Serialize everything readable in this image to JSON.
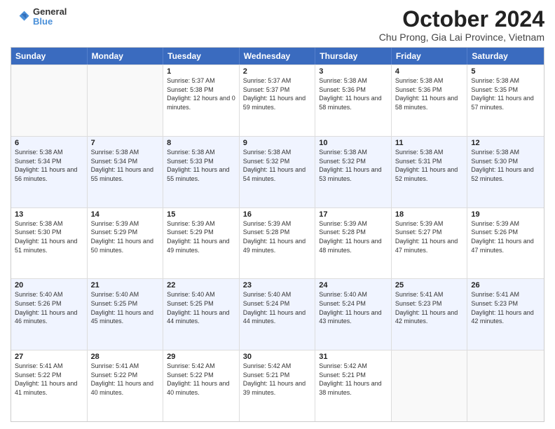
{
  "header": {
    "logo_line1": "General",
    "logo_line2": "Blue",
    "title": "October 2024",
    "subtitle": "Chu Prong, Gia Lai Province, Vietnam"
  },
  "calendar": {
    "days_of_week": [
      "Sunday",
      "Monday",
      "Tuesday",
      "Wednesday",
      "Thursday",
      "Friday",
      "Saturday"
    ],
    "rows": [
      [
        {
          "day": "",
          "sunrise": "",
          "sunset": "",
          "daylight": "",
          "empty": true
        },
        {
          "day": "",
          "sunrise": "",
          "sunset": "",
          "daylight": "",
          "empty": true
        },
        {
          "day": "1",
          "sunrise": "Sunrise: 5:37 AM",
          "sunset": "Sunset: 5:38 PM",
          "daylight": "Daylight: 12 hours and 0 minutes."
        },
        {
          "day": "2",
          "sunrise": "Sunrise: 5:37 AM",
          "sunset": "Sunset: 5:37 PM",
          "daylight": "Daylight: 11 hours and 59 minutes."
        },
        {
          "day": "3",
          "sunrise": "Sunrise: 5:38 AM",
          "sunset": "Sunset: 5:36 PM",
          "daylight": "Daylight: 11 hours and 58 minutes."
        },
        {
          "day": "4",
          "sunrise": "Sunrise: 5:38 AM",
          "sunset": "Sunset: 5:36 PM",
          "daylight": "Daylight: 11 hours and 58 minutes."
        },
        {
          "day": "5",
          "sunrise": "Sunrise: 5:38 AM",
          "sunset": "Sunset: 5:35 PM",
          "daylight": "Daylight: 11 hours and 57 minutes."
        }
      ],
      [
        {
          "day": "6",
          "sunrise": "Sunrise: 5:38 AM",
          "sunset": "Sunset: 5:34 PM",
          "daylight": "Daylight: 11 hours and 56 minutes."
        },
        {
          "day": "7",
          "sunrise": "Sunrise: 5:38 AM",
          "sunset": "Sunset: 5:34 PM",
          "daylight": "Daylight: 11 hours and 55 minutes."
        },
        {
          "day": "8",
          "sunrise": "Sunrise: 5:38 AM",
          "sunset": "Sunset: 5:33 PM",
          "daylight": "Daylight: 11 hours and 55 minutes."
        },
        {
          "day": "9",
          "sunrise": "Sunrise: 5:38 AM",
          "sunset": "Sunset: 5:32 PM",
          "daylight": "Daylight: 11 hours and 54 minutes."
        },
        {
          "day": "10",
          "sunrise": "Sunrise: 5:38 AM",
          "sunset": "Sunset: 5:32 PM",
          "daylight": "Daylight: 11 hours and 53 minutes."
        },
        {
          "day": "11",
          "sunrise": "Sunrise: 5:38 AM",
          "sunset": "Sunset: 5:31 PM",
          "daylight": "Daylight: 11 hours and 52 minutes."
        },
        {
          "day": "12",
          "sunrise": "Sunrise: 5:38 AM",
          "sunset": "Sunset: 5:30 PM",
          "daylight": "Daylight: 11 hours and 52 minutes."
        }
      ],
      [
        {
          "day": "13",
          "sunrise": "Sunrise: 5:38 AM",
          "sunset": "Sunset: 5:30 PM",
          "daylight": "Daylight: 11 hours and 51 minutes."
        },
        {
          "day": "14",
          "sunrise": "Sunrise: 5:39 AM",
          "sunset": "Sunset: 5:29 PM",
          "daylight": "Daylight: 11 hours and 50 minutes."
        },
        {
          "day": "15",
          "sunrise": "Sunrise: 5:39 AM",
          "sunset": "Sunset: 5:29 PM",
          "daylight": "Daylight: 11 hours and 49 minutes."
        },
        {
          "day": "16",
          "sunrise": "Sunrise: 5:39 AM",
          "sunset": "Sunset: 5:28 PM",
          "daylight": "Daylight: 11 hours and 49 minutes."
        },
        {
          "day": "17",
          "sunrise": "Sunrise: 5:39 AM",
          "sunset": "Sunset: 5:28 PM",
          "daylight": "Daylight: 11 hours and 48 minutes."
        },
        {
          "day": "18",
          "sunrise": "Sunrise: 5:39 AM",
          "sunset": "Sunset: 5:27 PM",
          "daylight": "Daylight: 11 hours and 47 minutes."
        },
        {
          "day": "19",
          "sunrise": "Sunrise: 5:39 AM",
          "sunset": "Sunset: 5:26 PM",
          "daylight": "Daylight: 11 hours and 47 minutes."
        }
      ],
      [
        {
          "day": "20",
          "sunrise": "Sunrise: 5:40 AM",
          "sunset": "Sunset: 5:26 PM",
          "daylight": "Daylight: 11 hours and 46 minutes."
        },
        {
          "day": "21",
          "sunrise": "Sunrise: 5:40 AM",
          "sunset": "Sunset: 5:25 PM",
          "daylight": "Daylight: 11 hours and 45 minutes."
        },
        {
          "day": "22",
          "sunrise": "Sunrise: 5:40 AM",
          "sunset": "Sunset: 5:25 PM",
          "daylight": "Daylight: 11 hours and 44 minutes."
        },
        {
          "day": "23",
          "sunrise": "Sunrise: 5:40 AM",
          "sunset": "Sunset: 5:24 PM",
          "daylight": "Daylight: 11 hours and 44 minutes."
        },
        {
          "day": "24",
          "sunrise": "Sunrise: 5:40 AM",
          "sunset": "Sunset: 5:24 PM",
          "daylight": "Daylight: 11 hours and 43 minutes."
        },
        {
          "day": "25",
          "sunrise": "Sunrise: 5:41 AM",
          "sunset": "Sunset: 5:23 PM",
          "daylight": "Daylight: 11 hours and 42 minutes."
        },
        {
          "day": "26",
          "sunrise": "Sunrise: 5:41 AM",
          "sunset": "Sunset: 5:23 PM",
          "daylight": "Daylight: 11 hours and 42 minutes."
        }
      ],
      [
        {
          "day": "27",
          "sunrise": "Sunrise: 5:41 AM",
          "sunset": "Sunset: 5:22 PM",
          "daylight": "Daylight: 11 hours and 41 minutes."
        },
        {
          "day": "28",
          "sunrise": "Sunrise: 5:41 AM",
          "sunset": "Sunset: 5:22 PM",
          "daylight": "Daylight: 11 hours and 40 minutes."
        },
        {
          "day": "29",
          "sunrise": "Sunrise: 5:42 AM",
          "sunset": "Sunset: 5:22 PM",
          "daylight": "Daylight: 11 hours and 40 minutes."
        },
        {
          "day": "30",
          "sunrise": "Sunrise: 5:42 AM",
          "sunset": "Sunset: 5:21 PM",
          "daylight": "Daylight: 11 hours and 39 minutes."
        },
        {
          "day": "31",
          "sunrise": "Sunrise: 5:42 AM",
          "sunset": "Sunset: 5:21 PM",
          "daylight": "Daylight: 11 hours and 38 minutes."
        },
        {
          "day": "",
          "sunrise": "",
          "sunset": "",
          "daylight": "",
          "empty": true
        },
        {
          "day": "",
          "sunrise": "",
          "sunset": "",
          "daylight": "",
          "empty": true
        }
      ]
    ]
  }
}
